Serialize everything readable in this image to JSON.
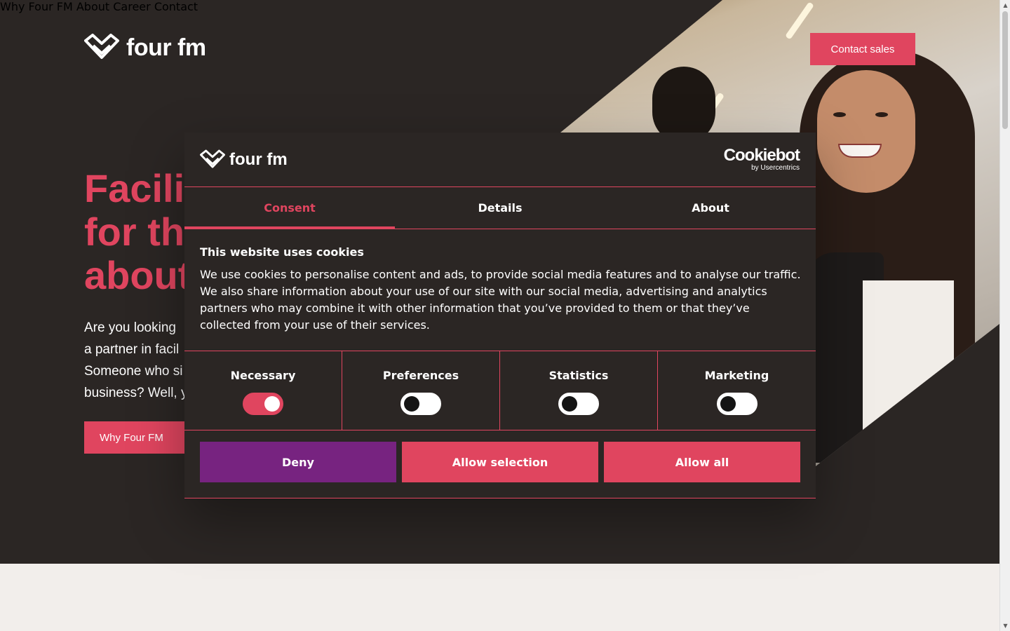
{
  "site": {
    "logo_text": "four fm",
    "nav": [
      "Why Four FM",
      "About",
      "Career",
      "Contact"
    ],
    "cta": "Contact sales",
    "hero_title_lines": [
      "Facili",
      "for th",
      "about"
    ],
    "hero_text_lines": [
      "Are you looking",
      "a partner in facil",
      "Someone who si",
      "business? Well, y"
    ],
    "hero_button": "Why Four FM"
  },
  "dialog": {
    "logo_text": "four fm",
    "provider_name": "Cookiebot",
    "provider_sub": "by Usercentrics",
    "tabs": [
      "Consent",
      "Details",
      "About"
    ],
    "active_tab": "Consent",
    "heading": "This website uses cookies",
    "body": "We use cookies to personalise content and ads, to provide social media features and to analyse our traffic. We also share information about your use of our site with our social media, advertising and analytics partners who may combine it with other information that you’ve provided to them or that they’ve collected from your use of their services.",
    "categories": [
      {
        "label": "Necessary",
        "enabled": true
      },
      {
        "label": "Preferences",
        "enabled": false
      },
      {
        "label": "Statistics",
        "enabled": false
      },
      {
        "label": "Marketing",
        "enabled": false
      }
    ],
    "buttons": {
      "deny": "Deny",
      "allow_selection": "Allow selection",
      "allow_all": "Allow all"
    }
  },
  "colors": {
    "accent": "#e0455f",
    "background": "#2b2624",
    "deny": "#772380",
    "lower_section": "#f2eeeb"
  }
}
